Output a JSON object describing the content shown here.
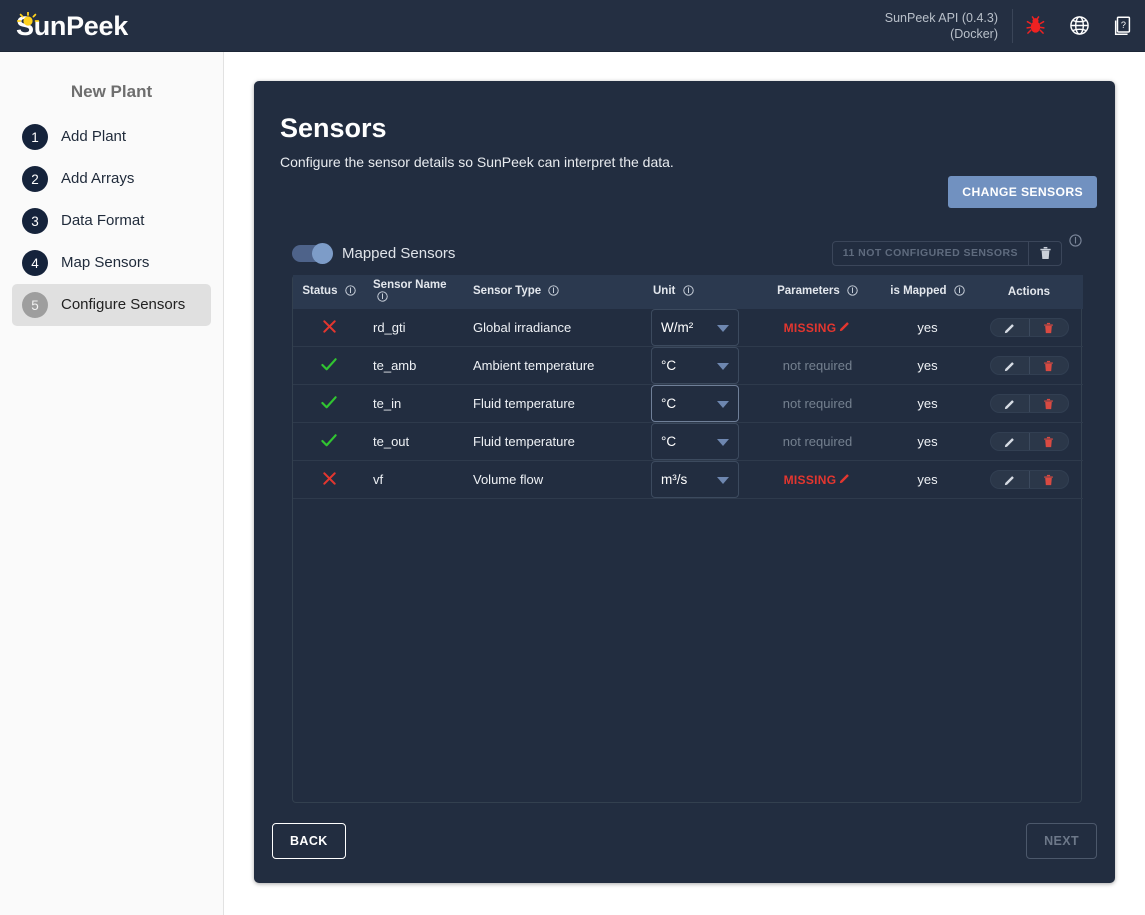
{
  "topbar": {
    "brand": "SunPeek",
    "api_line1": "SunPeek API (0.4.3)",
    "api_line2": "(Docker)",
    "icons": [
      "bug-icon",
      "globe-icon",
      "help-pages-icon"
    ],
    "bug_color": "#ee2222",
    "bg": "#242f42"
  },
  "sidebar": {
    "title": "New Plant",
    "items": [
      {
        "num": "1",
        "label": "Add Plant",
        "active": false
      },
      {
        "num": "2",
        "label": "Add Arrays",
        "active": false
      },
      {
        "num": "3",
        "label": "Data Format",
        "active": false
      },
      {
        "num": "4",
        "label": "Map Sensors",
        "active": false
      },
      {
        "num": "5",
        "label": "Configure Sensors",
        "active": true
      }
    ]
  },
  "panel": {
    "title": "Sensors",
    "subtitle": "Configure the sensor details so SunPeek can interpret the data.",
    "change_sensors_label": "CHANGE SENSORS",
    "change_sensors_color": "#7191c0"
  },
  "toolbar": {
    "toggle_label": "Mapped Sensors",
    "toggle_on": true,
    "not_configured_chip": "11 NOT CONFIGURED SENSORS",
    "trash_icon": "trash-icon",
    "info_icon": "info-icon"
  },
  "table": {
    "headers": [
      {
        "label": "Status",
        "info": true
      },
      {
        "label": "Sensor Name",
        "info": true
      },
      {
        "label": "Sensor Type",
        "info": true
      },
      {
        "label": "Unit",
        "info": true
      },
      {
        "label": "Parameters",
        "info": true
      },
      {
        "label": "is Mapped",
        "info": true
      },
      {
        "label": "Actions",
        "info": false
      }
    ],
    "rows": [
      {
        "status": "error",
        "name": "rd_gti",
        "type": "Global irradiance",
        "unit": "W/m²",
        "unit_focused": false,
        "param": "MISSING",
        "param_state": "missing",
        "mapped": "yes"
      },
      {
        "status": "ok",
        "name": "te_amb",
        "type": "Ambient temperature",
        "unit": "°C",
        "unit_focused": false,
        "param": "not required",
        "param_state": "not-required",
        "mapped": "yes"
      },
      {
        "status": "ok",
        "name": "te_in",
        "type": "Fluid temperature",
        "unit": "°C",
        "unit_focused": true,
        "param": "not required",
        "param_state": "not-required",
        "mapped": "yes"
      },
      {
        "status": "ok",
        "name": "te_out",
        "type": "Fluid temperature",
        "unit": "°C",
        "unit_focused": false,
        "param": "not required",
        "param_state": "not-required",
        "mapped": "yes"
      },
      {
        "status": "error",
        "name": "vf",
        "type": "Volume flow",
        "unit": "m³/s",
        "unit_focused": false,
        "param": "MISSING",
        "param_state": "missing",
        "mapped": "yes"
      }
    ],
    "status_ok_color": "#31c531",
    "status_error_color": "#e4362f",
    "missing_color": "#e4362f"
  },
  "footer": {
    "back_label": "BACK",
    "next_label": "NEXT",
    "next_disabled": true
  }
}
